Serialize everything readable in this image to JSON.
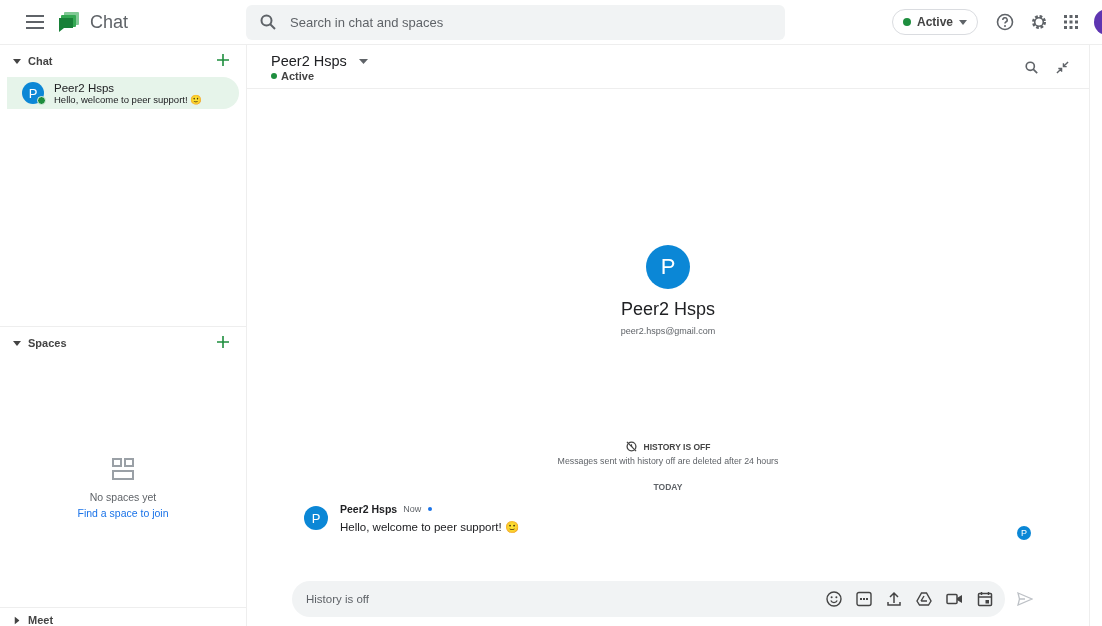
{
  "app": {
    "title": "Chat"
  },
  "search": {
    "placeholder": "Search in chat and spaces"
  },
  "status": {
    "label": "Active",
    "color": "#1e8e3e"
  },
  "account": {
    "color": "#5e35b1"
  },
  "sidebar": {
    "chat": {
      "title": "Chat",
      "expanded": true,
      "items": [
        {
          "initial": "P",
          "name": "Peer2 Hsps",
          "preview": "Hello, welcome to peer support! 🙂",
          "online": true,
          "selected": true
        }
      ]
    },
    "spaces": {
      "title": "Spaces",
      "expanded": true,
      "empty_title": "No spaces yet",
      "empty_link": "Find a space to join"
    },
    "meet": {
      "title": "Meet",
      "expanded": false
    }
  },
  "conversation": {
    "title": "Peer2 Hsps",
    "status": {
      "label": "Active",
      "color": "#1e8e3e"
    },
    "profile": {
      "initial": "P",
      "name": "Peer2 Hsps",
      "email": "peer2.hsps@gmail.com"
    },
    "history_title": "HISTORY IS OFF",
    "history_note": "Messages sent with history off are deleted after 24 hours",
    "date_divider": "TODAY",
    "messages": [
      {
        "initial": "P",
        "sender": "Peer2 Hsps",
        "time": "Now",
        "unread": true,
        "text": "Hello, welcome to peer support! 🙂",
        "read_initial": "P"
      }
    ],
    "composer": {
      "placeholder": "History is off"
    }
  }
}
